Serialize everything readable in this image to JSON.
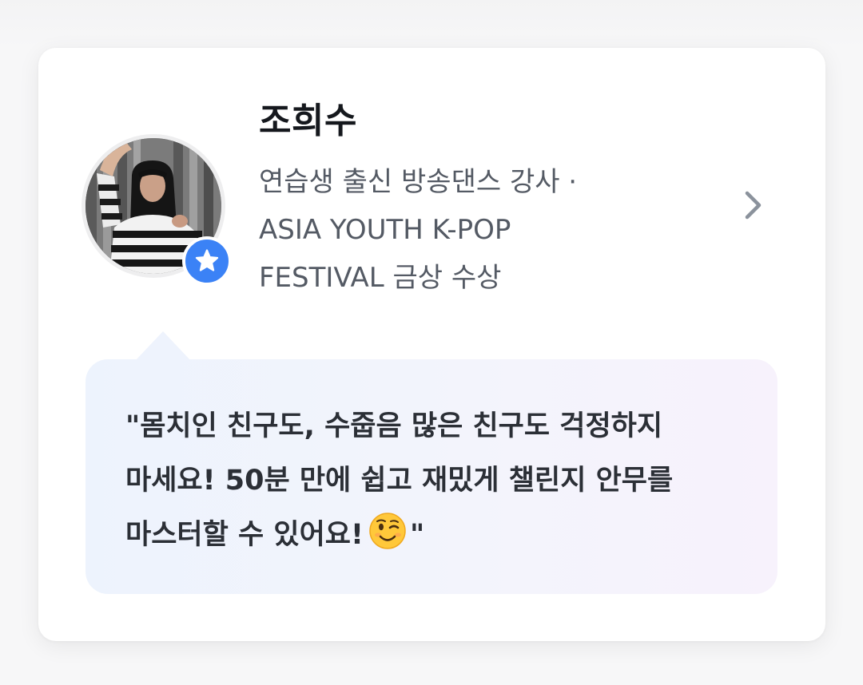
{
  "instructor": {
    "name": "조희수",
    "bio_lines": [
      "연습생 출신 방송댄스 강사 ·",
      "ASIA YOUTH K-POP",
      "FESTIVAL 금상 수상"
    ]
  },
  "quote": {
    "lines": [
      "\"몸치인 친구도, 수줍음 많은 친구도 걱정하지",
      "마세요! 50분 만에 쉽고 재밌게 챌린지 안무를",
      "마스터할 수 있어요!"
    ],
    "closing": "\"",
    "emoji": "winking-face"
  },
  "colors": {
    "badge": "#3b82f6",
    "chevron": "#8b929c"
  },
  "icons": {
    "badge": "star-icon",
    "chevron": "chevron-right-icon"
  }
}
